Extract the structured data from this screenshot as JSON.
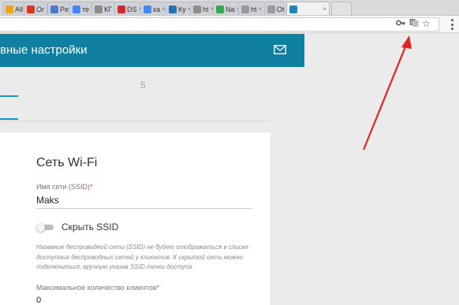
{
  "browser": {
    "tabs": [
      {
        "label": "All",
        "color": "#f1a40f"
      },
      {
        "label": "Or",
        "color": "#d9351d"
      },
      {
        "label": "Pe",
        "color": "#4a7cc9"
      },
      {
        "label": "те",
        "color": "#4285f4"
      },
      {
        "label": "КГ",
        "color": "#8b8b8b"
      },
      {
        "label": "DS",
        "color": "#d6272a"
      },
      {
        "label": "ка",
        "color": "#4285f4"
      },
      {
        "label": "Ку",
        "color": "#2b6fb3"
      },
      {
        "label": "ht",
        "color": "#8b8b8b"
      },
      {
        "label": "Na",
        "color": "#36a852"
      },
      {
        "label": "ht",
        "color": "#999999"
      },
      {
        "label": "Ot",
        "color": "#9a9a9a"
      },
      {
        "label": "",
        "color": "#1889b8",
        "active": true
      }
    ],
    "toolbar_icons": [
      "key-icon",
      "translate-icon",
      "bookmark-star-icon",
      "menu-icon"
    ]
  },
  "header": {
    "title": "вные настройки",
    "mail_icon": "mail-icon"
  },
  "tabs": {
    "number": "5"
  },
  "wifi": {
    "title": "Сеть Wi-Fi",
    "ssid_label": "Имя сети (SSID)",
    "required_mark": "*",
    "ssid_value": "Maks",
    "hide_ssid_label": "Скрыть SSID",
    "hide_ssid_enabled": false,
    "hint": "Название беспроводной сети (SSID) не будет отображаться в списке доступных беспроводных сетей у клиентов. К скрытой сети можно подключиться, вручную указав SSID точки доступа",
    "max_clients_label": "Максимальное количество клиентов",
    "max_clients_value": "0"
  },
  "colors": {
    "header_bg": "#0f7fa2",
    "accent": "#1696c0",
    "annotation_arrow": "#e0261f"
  }
}
